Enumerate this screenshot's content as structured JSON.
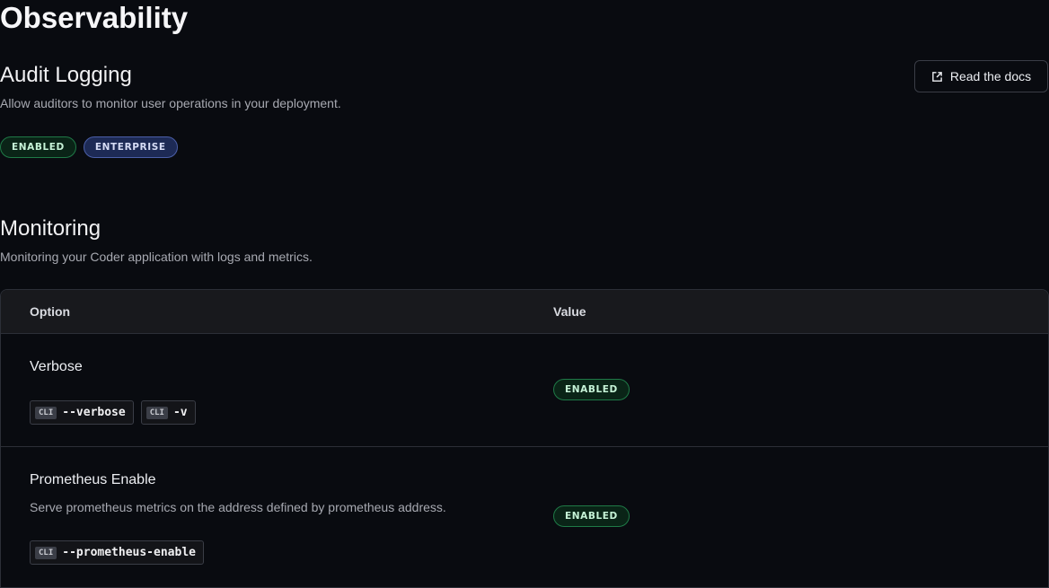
{
  "page": {
    "title": "Observability"
  },
  "audit": {
    "title": "Audit Logging",
    "description": "Allow auditors to monitor user operations in your deployment.",
    "docs_button": "Read the docs",
    "badges": [
      "ENABLED",
      "ENTERPRISE"
    ]
  },
  "monitoring": {
    "title": "Monitoring",
    "description": "Monitoring your Coder application with logs and metrics.",
    "table": {
      "headers": {
        "option": "Option",
        "value": "Value"
      },
      "rows": [
        {
          "name": "Verbose",
          "description": "",
          "cli_flags": [
            "--verbose",
            "-v"
          ],
          "value": "ENABLED"
        },
        {
          "name": "Prometheus Enable",
          "description": "Serve prometheus metrics on the address defined by prometheus address.",
          "cli_flags": [
            "--prometheus-enable"
          ],
          "value": "ENABLED"
        }
      ]
    }
  },
  "cli_tag": "CLI",
  "colors": {
    "background": "#090b10",
    "enabled_border": "#1f7a47",
    "enterprise_border": "#4b5fa8"
  },
  "icons": {
    "docs": "external-link-icon"
  }
}
